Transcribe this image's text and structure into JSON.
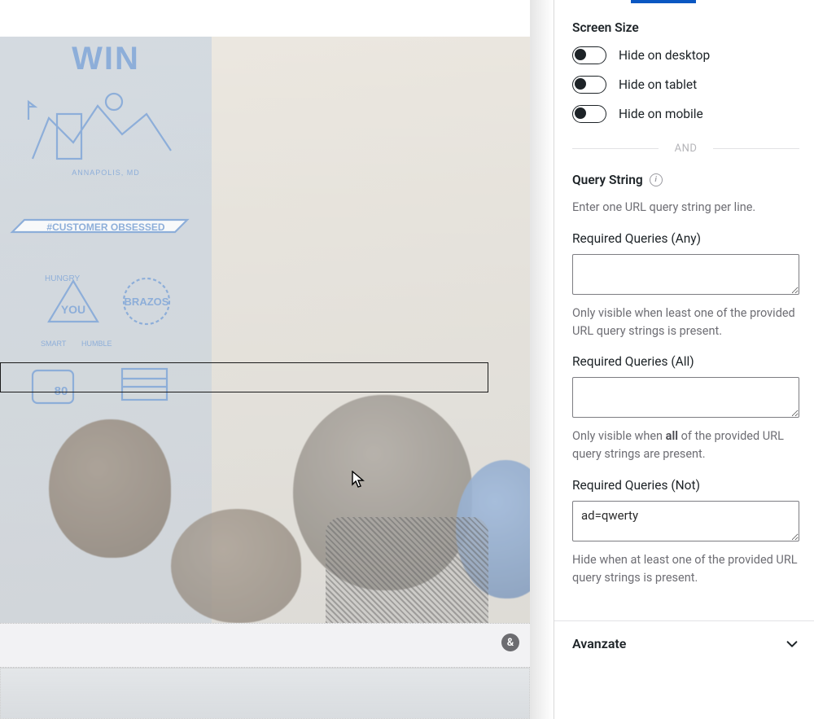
{
  "sidebar": {
    "screenSize": {
      "heading": "Screen Size",
      "toggles": [
        {
          "label": "Hide on desktop",
          "on": false
        },
        {
          "label": "Hide on tablet",
          "on": false
        },
        {
          "label": "Hide on mobile",
          "on": false
        }
      ]
    },
    "divider": "AND",
    "queryString": {
      "heading": "Query String",
      "intro": "Enter one URL query string per line.",
      "fields": {
        "any": {
          "label": "Required Queries (Any)",
          "value": "",
          "help_pre": "Only visible when least one of the provided URL query strings is present."
        },
        "all": {
          "label": "Required Queries (All)",
          "value": "",
          "help_pre": "Only visible when ",
          "help_bold": "all",
          "help_post": " of the provided URL query strings are present."
        },
        "not": {
          "label": "Required Queries (Not)",
          "value": "ad=qwerty",
          "help_pre": "Hide when at least one of the provided URL query strings is present."
        }
      }
    },
    "advanced": {
      "label": "Avanzate"
    }
  },
  "canvas": {
    "illustration": {
      "title": "WIN",
      "city_label": "ANNAPOLIS, MD",
      "banner": "#CUSTOMER OBSESSED",
      "words": [
        "HUNGRY",
        "YOU",
        "SMART",
        "HUMBLE",
        "BRAZOS"
      ],
      "number": "80"
    },
    "badge": "&"
  }
}
